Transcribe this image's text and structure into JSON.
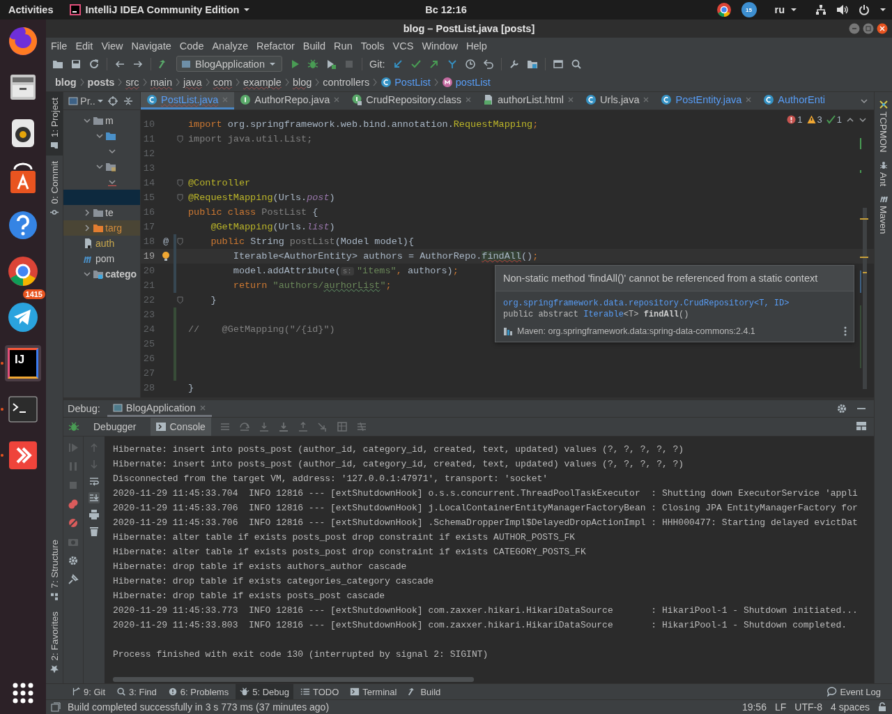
{
  "top_bar": {
    "activities": "Activities",
    "app_menu": "IntelliJ IDEA Community Edition",
    "clock": "Вс 12:16",
    "update_badge": "15",
    "language": "ru"
  },
  "dock": [
    {
      "kind": "firefox",
      "running": false,
      "selected": false
    },
    {
      "kind": "files",
      "running": false,
      "selected": false
    },
    {
      "kind": "speaker",
      "running": false,
      "selected": false
    },
    {
      "kind": "store",
      "running": false,
      "selected": false
    },
    {
      "kind": "help",
      "running": false,
      "selected": false
    },
    {
      "kind": "chrome",
      "running": false,
      "selected": false
    },
    {
      "kind": "telegram",
      "running": false,
      "selected": false,
      "badge": "1415"
    },
    {
      "kind": "ide",
      "running": true,
      "selected": true,
      "logo": "IJ"
    },
    {
      "kind": "terminal",
      "running": true,
      "selected": false
    },
    {
      "kind": "remote",
      "running": true,
      "selected": false
    }
  ],
  "window": {
    "title": "blog – PostList.java [posts]"
  },
  "menu": [
    "File",
    "Edit",
    "View",
    "Navigate",
    "Code",
    "Analyze",
    "Refactor",
    "Build",
    "Run",
    "Tools",
    "VCS",
    "Window",
    "Help"
  ],
  "toolbar": {
    "run_config": "BlogApplication",
    "git_label": "Git:"
  },
  "breadcrumbs": [
    {
      "label": "blog",
      "kind": "module",
      "error": false
    },
    {
      "label": "posts",
      "kind": "module",
      "error": false
    },
    {
      "label": "src",
      "kind": "folder",
      "error": true
    },
    {
      "label": "main",
      "kind": "folder",
      "error": true
    },
    {
      "label": "java",
      "kind": "folder",
      "error": true
    },
    {
      "label": "com",
      "kind": "folder",
      "error": true
    },
    {
      "label": "example",
      "kind": "folder",
      "error": true
    },
    {
      "label": "blog",
      "kind": "folder",
      "error": true
    },
    {
      "label": "controllers",
      "kind": "folder",
      "error": false
    },
    {
      "label": "PostList",
      "kind": "class",
      "error": false
    },
    {
      "label": "postList",
      "kind": "method",
      "error": false
    }
  ],
  "tool_windows_left_top": [
    {
      "label": "1: Project",
      "selected": true
    },
    {
      "label": "0: Commit",
      "selected": false
    }
  ],
  "tool_windows_left_bottom": [
    {
      "label": "7: Structure",
      "selected": false
    },
    {
      "label": "2: Favorites",
      "selected": false
    }
  ],
  "tool_windows_right": [
    {
      "label": "TCPMON",
      "selected": false
    },
    {
      "label": "Ant",
      "selected": false
    },
    {
      "label": "Maven",
      "selected": false
    }
  ],
  "project": {
    "title": "Pr..",
    "tree": [
      {
        "label": "m",
        "kind": "folder",
        "expanded": true,
        "selected": false,
        "children": [
          {
            "kind": "folder-source",
            "expanded": true,
            "selected": false,
            "children": [
              {
                "expanded": true,
                "selected": false
              }
            ]
          },
          {
            "kind": "folder-resources",
            "expanded": true,
            "selected": false,
            "children": [
              {
                "expanded": true,
                "selected": false,
                "error": true
              }
            ]
          }
        ]
      },
      {
        "selected": true
      },
      {
        "label": "te",
        "kind": "folder",
        "expanded": false,
        "selected": false
      },
      {
        "label": "targ",
        "kind": "folder-excluded",
        "expanded": false,
        "selected": false
      },
      {
        "label": "auth",
        "kind": "file",
        "selected": false
      },
      {
        "label": "pom",
        "kind": "maven",
        "selected": false
      },
      {
        "label": "catego",
        "kind": "module",
        "expanded": true,
        "selected": false
      }
    ]
  },
  "tabs": [
    {
      "label": "PostList.java",
      "kind": "class",
      "selected": true,
      "modified": true,
      "error": true
    },
    {
      "label": "AuthorRepo.java",
      "kind": "interface",
      "selected": false,
      "modified": false,
      "error": false
    },
    {
      "label": "CrudRepository.class",
      "kind": "interface-locked",
      "selected": false,
      "modified": false,
      "error": false
    },
    {
      "label": "authorList.html",
      "kind": "html",
      "selected": false,
      "modified": false,
      "error": false
    },
    {
      "label": "Urls.java",
      "kind": "class",
      "selected": false,
      "modified": false,
      "error": false
    },
    {
      "label": "PostEntity.java",
      "kind": "class",
      "selected": false,
      "modified": true,
      "error": false
    },
    {
      "label": "AuthorEnti",
      "kind": "class",
      "selected": false,
      "modified": true,
      "error": false
    }
  ],
  "inspections": {
    "errors": "1",
    "warnings": "3",
    "typos": "1"
  },
  "code": [
    {
      "number": "10",
      "current": false,
      "tokens": [
        {
          "kind": "kw",
          "text": "import"
        },
        {
          "kind": "plain",
          "text": " org.springframework.web.bind.annotation."
        },
        {
          "kind": "ann",
          "text": "RequestMapping"
        },
        {
          "kind": "kw",
          "text": ";"
        }
      ]
    },
    {
      "number": "11",
      "current": false,
      "fold": true,
      "tokens": [
        {
          "kind": "unused",
          "text": "import java.util.List;"
        }
      ]
    },
    {
      "number": "12",
      "current": false
    },
    {
      "number": "13",
      "current": false
    },
    {
      "number": "14",
      "current": false,
      "fold": true,
      "tokens": [
        {
          "kind": "ann",
          "text": "@Controller"
        }
      ]
    },
    {
      "number": "15",
      "current": false,
      "fold": true,
      "tokens": [
        {
          "kind": "ann",
          "text": "@RequestMapping"
        },
        {
          "kind": "plain",
          "text": "(Urls."
        },
        {
          "kind": "field",
          "text": "post"
        },
        {
          "kind": "plain",
          "text": ")"
        }
      ]
    },
    {
      "number": "16",
      "current": false,
      "tokens": [
        {
          "kind": "kw",
          "text": "public class "
        },
        {
          "kind": "unused",
          "text": "PostList"
        },
        {
          "kind": "plain",
          "text": " {"
        }
      ]
    },
    {
      "number": "17",
      "current": false,
      "tokens": [
        {
          "kind": "ann",
          "text": "    @GetMapping"
        },
        {
          "kind": "plain",
          "text": "(Urls."
        },
        {
          "kind": "field",
          "text": "list"
        },
        {
          "kind": "plain",
          "text": ")"
        }
      ]
    },
    {
      "number": "18",
      "current": false,
      "fold": true,
      "gutter_text": "@",
      "modified": true,
      "tokens": [
        {
          "kind": "kw",
          "text": "    public "
        },
        {
          "kind": "plain",
          "text": "String "
        },
        {
          "kind": "unused",
          "text": "postList"
        },
        {
          "kind": "plain",
          "text": "(Model model){"
        }
      ]
    },
    {
      "number": "19",
      "current": true,
      "bulb": true,
      "modified": true,
      "tokens": [
        {
          "kind": "plain",
          "text": "        Iterable<AuthorEntity> authors = AuthorRepo."
        },
        {
          "kind": "err",
          "text": "findAll"
        },
        {
          "kind": "plain",
          "text": "()"
        },
        {
          "kind": "kw",
          "text": ";"
        }
      ]
    },
    {
      "number": "20",
      "current": false,
      "modified": true,
      "tokens": [
        {
          "kind": "plain",
          "text": "        model.addAttribute("
        },
        {
          "kind": "hint",
          "text": "s:"
        },
        {
          "kind": "str",
          "text": "\"items\""
        },
        {
          "kind": "kw",
          "text": ","
        },
        {
          "kind": "plain",
          "text": " authors)"
        },
        {
          "kind": "kw",
          "text": ";"
        }
      ]
    },
    {
      "number": "21",
      "current": false,
      "modified": true,
      "tokens": [
        {
          "kind": "kw",
          "text": "        return "
        },
        {
          "kind": "str",
          "text": "\"authors/"
        },
        {
          "kind": "typo",
          "text": "aurhorList"
        },
        {
          "kind": "str",
          "text": "\""
        },
        {
          "kind": "kw",
          "text": ";"
        }
      ]
    },
    {
      "number": "22",
      "current": false,
      "fold": true,
      "tokens": [
        {
          "kind": "plain",
          "text": "    }"
        }
      ]
    },
    {
      "number": "23",
      "current": false,
      "added": true
    },
    {
      "number": "24",
      "current": false,
      "added": true,
      "tokens": [
        {
          "kind": "comment",
          "text": "//    @GetMapping(\"/{id}\")"
        }
      ]
    },
    {
      "number": "25",
      "current": false,
      "added": true
    },
    {
      "number": "26",
      "current": false,
      "added": true
    },
    {
      "number": "27",
      "current": false,
      "added": true
    },
    {
      "number": "28",
      "current": false,
      "tokens": [
        {
          "kind": "plain",
          "text": "}"
        }
      ]
    }
  ],
  "tooltip": {
    "message": "Non-static method 'findAll()' cannot be referenced from a static context",
    "declaring_class": "org.springframework.data.repository.CrudRepository<T, ID>",
    "signature": [
      {
        "kind": "plain",
        "text": "public abstract "
      },
      {
        "kind": "link",
        "text": "Iterable"
      },
      {
        "kind": "plain",
        "text": "<T> "
      },
      {
        "kind": "bold",
        "text": "findAll"
      },
      {
        "kind": "plain",
        "text": "()"
      }
    ],
    "library": "Maven: org.springframework.data:spring-data-commons:2.4.1"
  },
  "debug": {
    "label": "Debug:",
    "session_tab": "BlogApplication",
    "tabs": [
      {
        "label": "Debugger",
        "selected": false
      },
      {
        "label": "Console",
        "selected": true
      }
    ],
    "console": [
      {
        "kind": "log",
        "text": "Hibernate: insert into posts_post (author_id, category_id, created, text, updated) values (?, ?, ?, ?, ?)"
      },
      {
        "kind": "log",
        "text": "Hibernate: insert into posts_post (author_id, category_id, created, text, updated) values (?, ?, ?, ?, ?)"
      },
      {
        "kind": "log",
        "text": "Disconnected from the target VM, address: '127.0.0.1:47971', transport: 'socket'"
      },
      {
        "kind": "log",
        "text": "2020-11-29 11:45:33.704  INFO 12816 --- [extShutdownHook] o.s.s.concurrent.ThreadPoolTaskExecutor  : Shutting down ExecutorService 'appli"
      },
      {
        "kind": "log",
        "text": "2020-11-29 11:45:33.706  INFO 12816 --- [extShutdownHook] j.LocalContainerEntityManagerFactoryBean : Closing JPA EntityManagerFactory for"
      },
      {
        "kind": "log",
        "text": "2020-11-29 11:45:33.706  INFO 12816 --- [extShutdownHook] .SchemaDropperImpl$DelayedDropActionImpl : HHH000477: Starting delayed evictDat"
      },
      {
        "kind": "log",
        "text": "Hibernate: alter table if exists posts_post drop constraint if exists AUTHOR_POSTS_FK"
      },
      {
        "kind": "log",
        "text": "Hibernate: alter table if exists posts_post drop constraint if exists CATEGORY_POSTS_FK"
      },
      {
        "kind": "log",
        "text": "Hibernate: drop table if exists authors_author cascade"
      },
      {
        "kind": "log",
        "text": "Hibernate: drop table if exists categories_category cascade"
      },
      {
        "kind": "log",
        "text": "Hibernate: drop table if exists posts_post cascade"
      },
      {
        "kind": "log",
        "text": "2020-11-29 11:45:33.773  INFO 12816 --- [extShutdownHook] com.zaxxer.hikari.HikariDataSource       : HikariPool-1 - Shutdown initiated..."
      },
      {
        "kind": "log",
        "text": "2020-11-29 11:45:33.803  INFO 12816 --- [extShutdownHook] com.zaxxer.hikari.HikariDataSource       : HikariPool-1 - Shutdown completed."
      },
      {
        "kind": "exit",
        "text": "Process finished with exit code 130 (interrupted by signal 2: SIGINT)"
      }
    ]
  },
  "bottom_tools": [
    {
      "label": "9: Git",
      "selected": false
    },
    {
      "label": "3: Find",
      "selected": false
    },
    {
      "label": "6: Problems",
      "selected": false
    },
    {
      "label": "5: Debug",
      "selected": true
    },
    {
      "label": "TODO",
      "selected": false
    },
    {
      "label": "Terminal",
      "selected": false
    },
    {
      "label": "Build",
      "selected": false
    }
  ],
  "event_log": "Event Log",
  "status_bar": {
    "message": "Build completed successfully in 3 s 773 ms (37 minutes ago)",
    "position": "19:56",
    "line_separator": "LF",
    "encoding": "UTF-8",
    "indent": "4 spaces"
  }
}
